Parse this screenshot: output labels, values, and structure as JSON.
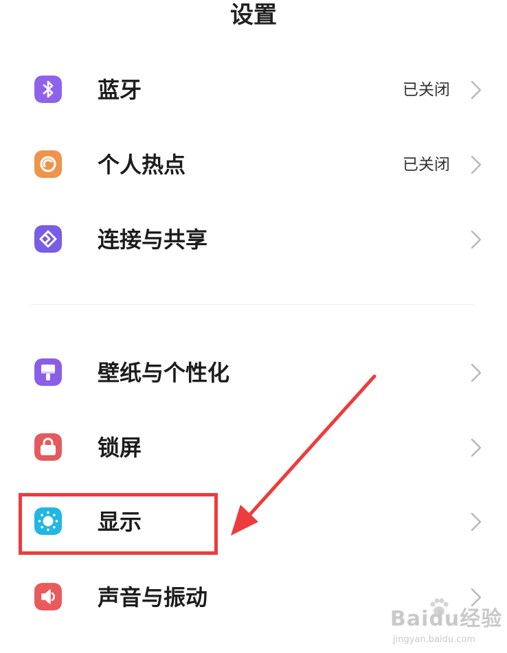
{
  "header": {
    "title": "设置"
  },
  "sections": [
    {
      "items": [
        {
          "label": "蓝牙",
          "status": "已关闭",
          "icon": "bluetooth-icon",
          "color": "#8e63ea"
        },
        {
          "label": "个人热点",
          "status": "已关闭",
          "icon": "hotspot-icon",
          "color": "#f0934b"
        },
        {
          "label": "连接与共享",
          "status": "",
          "icon": "share-icon",
          "color": "#7a5ce6"
        }
      ]
    },
    {
      "items": [
        {
          "label": "壁纸与个性化",
          "status": "",
          "icon": "paintbrush-icon",
          "color": "#8b5ee8"
        },
        {
          "label": "锁屏",
          "status": "",
          "icon": "lock-icon",
          "color": "#e45a5e"
        },
        {
          "label": "显示",
          "status": "",
          "icon": "sun-icon",
          "color": "#22b6e3"
        },
        {
          "label": "声音与振动",
          "status": "",
          "icon": "speaker-icon",
          "color": "#e95a5c"
        }
      ]
    }
  ],
  "annotation": {
    "highlight_color": "#ee3b3b",
    "highlighted_item": "显示"
  },
  "watermark": {
    "brand": "Baidu经验",
    "url": "jingyan.baidu.com"
  }
}
